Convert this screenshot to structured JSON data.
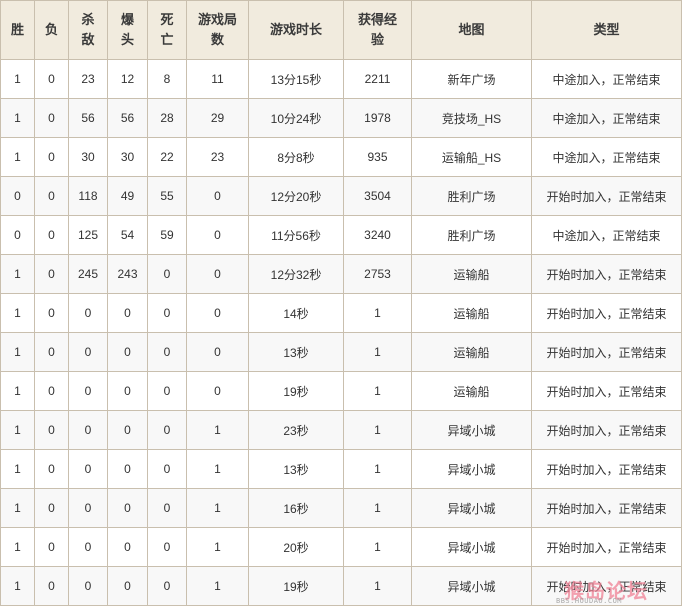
{
  "headers": {
    "win": "胜",
    "lose": "负",
    "kills_line1": "杀",
    "kills_line2": "敌",
    "headshots_line1": "爆",
    "headshots_line2": "头",
    "deaths_line1": "死",
    "deaths_line2": "亡",
    "rounds_line1": "游戏局",
    "rounds_line2": "数",
    "duration": "游戏时长",
    "exp_line1": "获得经",
    "exp_line2": "验",
    "map": "地图",
    "type": "类型"
  },
  "rows": [
    {
      "win": "1",
      "lose": "0",
      "kills": "23",
      "headshots": "12",
      "deaths": "8",
      "rounds": "11",
      "duration": "13分15秒",
      "exp": "2211",
      "map": "新年广场",
      "type": "中途加入，正常结束"
    },
    {
      "win": "1",
      "lose": "0",
      "kills": "56",
      "headshots": "56",
      "deaths": "28",
      "rounds": "29",
      "duration": "10分24秒",
      "exp": "1978",
      "map": "竞技场_HS",
      "type": "中途加入，正常结束"
    },
    {
      "win": "1",
      "lose": "0",
      "kills": "30",
      "headshots": "30",
      "deaths": "22",
      "rounds": "23",
      "duration": "8分8秒",
      "exp": "935",
      "map": "运输船_HS",
      "type": "中途加入，正常结束"
    },
    {
      "win": "0",
      "lose": "0",
      "kills": "118",
      "headshots": "49",
      "deaths": "55",
      "rounds": "0",
      "duration": "12分20秒",
      "exp": "3504",
      "map": "胜利广场",
      "type": "开始时加入，正常结束"
    },
    {
      "win": "0",
      "lose": "0",
      "kills": "125",
      "headshots": "54",
      "deaths": "59",
      "rounds": "0",
      "duration": "11分56秒",
      "exp": "3240",
      "map": "胜利广场",
      "type": "中途加入，正常结束"
    },
    {
      "win": "1",
      "lose": "0",
      "kills": "245",
      "headshots": "243",
      "deaths": "0",
      "rounds": "0",
      "duration": "12分32秒",
      "exp": "2753",
      "map": "运输船",
      "type": "开始时加入，正常结束"
    },
    {
      "win": "1",
      "lose": "0",
      "kills": "0",
      "headshots": "0",
      "deaths": "0",
      "rounds": "0",
      "duration": "14秒",
      "exp": "1",
      "map": "运输船",
      "type": "开始时加入，正常结束"
    },
    {
      "win": "1",
      "lose": "0",
      "kills": "0",
      "headshots": "0",
      "deaths": "0",
      "rounds": "0",
      "duration": "13秒",
      "exp": "1",
      "map": "运输船",
      "type": "开始时加入，正常结束"
    },
    {
      "win": "1",
      "lose": "0",
      "kills": "0",
      "headshots": "0",
      "deaths": "0",
      "rounds": "0",
      "duration": "19秒",
      "exp": "1",
      "map": "运输船",
      "type": "开始时加入，正常结束"
    },
    {
      "win": "1",
      "lose": "0",
      "kills": "0",
      "headshots": "0",
      "deaths": "0",
      "rounds": "1",
      "duration": "23秒",
      "exp": "1",
      "map": "异域小城",
      "type": "开始时加入，正常结束"
    },
    {
      "win": "1",
      "lose": "0",
      "kills": "0",
      "headshots": "0",
      "deaths": "0",
      "rounds": "1",
      "duration": "13秒",
      "exp": "1",
      "map": "异域小城",
      "type": "开始时加入，正常结束"
    },
    {
      "win": "1",
      "lose": "0",
      "kills": "0",
      "headshots": "0",
      "deaths": "0",
      "rounds": "1",
      "duration": "16秒",
      "exp": "1",
      "map": "异域小城",
      "type": "开始时加入，正常结束"
    },
    {
      "win": "1",
      "lose": "0",
      "kills": "0",
      "headshots": "0",
      "deaths": "0",
      "rounds": "1",
      "duration": "20秒",
      "exp": "1",
      "map": "异域小城",
      "type": "开始时加入，正常结束"
    },
    {
      "win": "1",
      "lose": "0",
      "kills": "0",
      "headshots": "0",
      "deaths": "0",
      "rounds": "1",
      "duration": "19秒",
      "exp": "1",
      "map": "异域小城",
      "type": "开始时加入，正常结束"
    }
  ],
  "watermark": {
    "main": "猴岛论坛",
    "sub": "BBS.HOUDAO.COM"
  },
  "colors": {
    "header_bg": "#f1ebde",
    "border": "#c9bfae",
    "row_alt_bg": "#f8f8f8"
  }
}
